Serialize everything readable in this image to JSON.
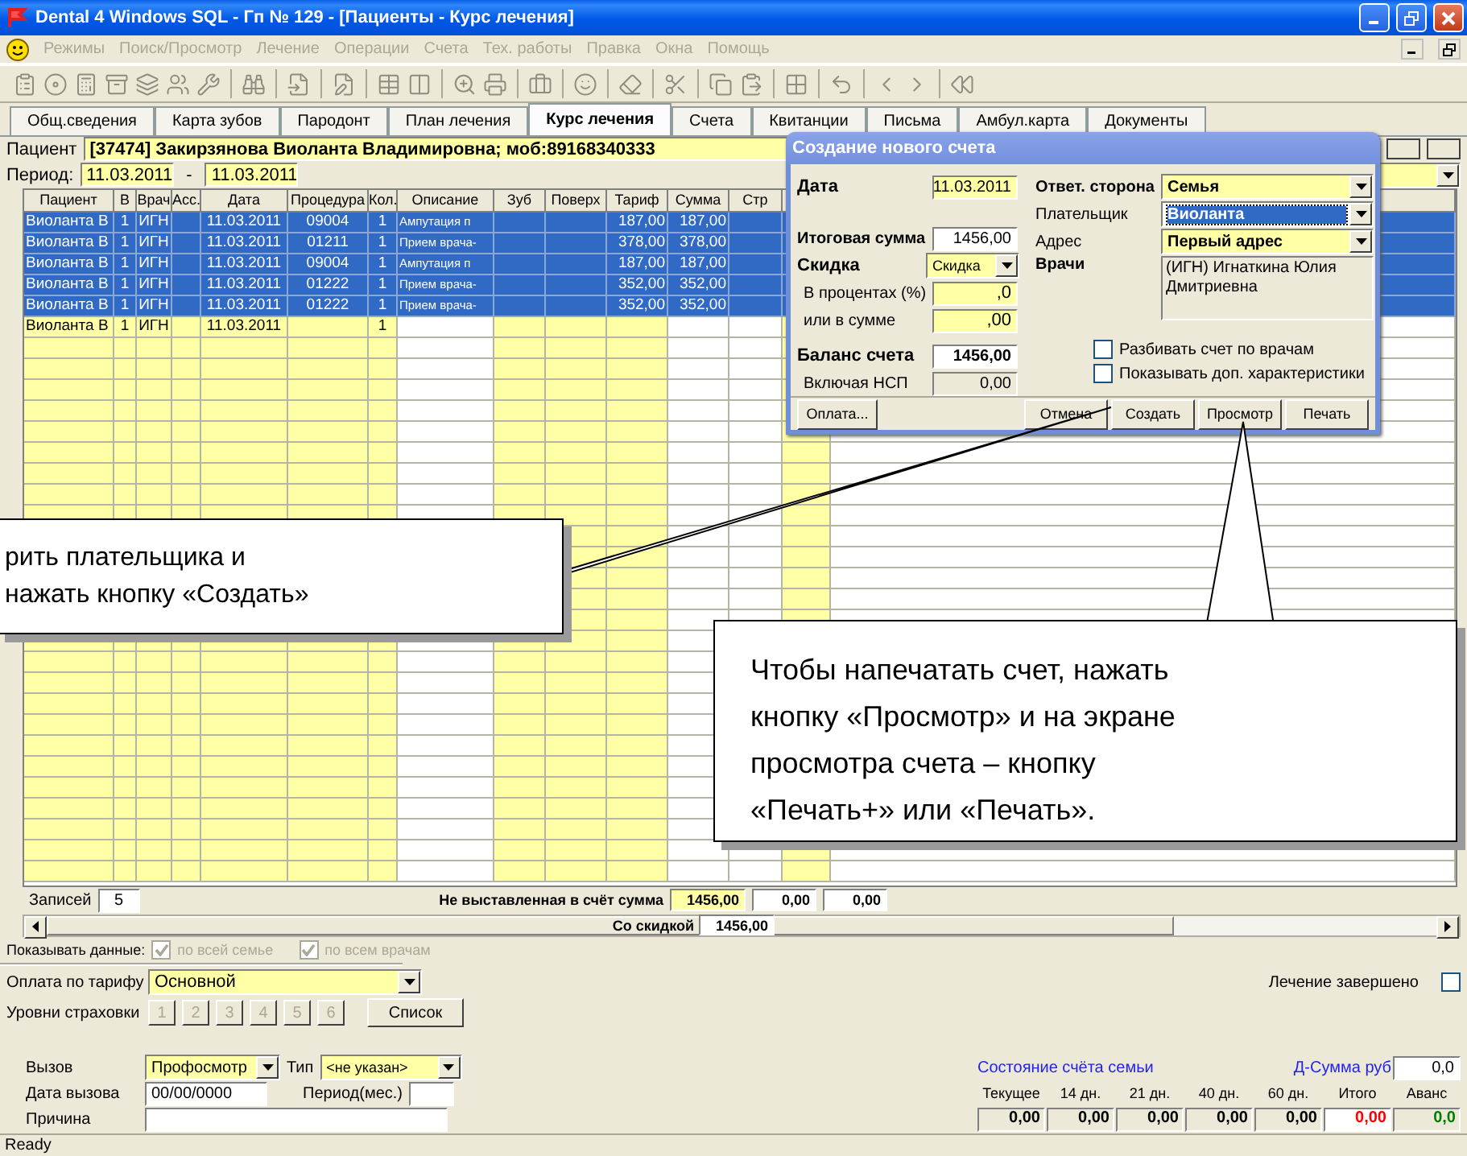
{
  "window": {
    "title": "Dental 4 Windows SQL - Гп № 129 - [Пациенты - Курс лечения]"
  },
  "menu": [
    {
      "label": "Режимы",
      "disabled": true
    },
    {
      "label": "Поиск/Просмотр",
      "disabled": true
    },
    {
      "label": "Лечение",
      "disabled": true
    },
    {
      "label": "Операции",
      "disabled": true
    },
    {
      "label": "Счета",
      "disabled": true
    },
    {
      "label": "Тех. работы",
      "disabled": true
    },
    {
      "label": "Правка",
      "disabled": true
    },
    {
      "label": "Окна",
      "disabled": true
    },
    {
      "label": "Помощь",
      "disabled": true
    }
  ],
  "tabs": [
    {
      "label": "Общ.сведения",
      "selected": false
    },
    {
      "label": "Карта зубов",
      "selected": false
    },
    {
      "label": "Пародонт",
      "selected": false
    },
    {
      "label": "План лечения",
      "selected": false
    },
    {
      "label": "Курс лечения",
      "selected": true
    },
    {
      "label": "Счета",
      "selected": false
    },
    {
      "label": "Квитанции",
      "selected": false
    },
    {
      "label": "Письма",
      "selected": false
    },
    {
      "label": "Амбул.карта",
      "selected": false
    },
    {
      "label": "Документы",
      "selected": false
    }
  ],
  "patient": {
    "label": "Пациент",
    "value": "[37474] Закирзянова Виоланта Владимировна; моб:89168340333"
  },
  "period": {
    "label": "Период:",
    "from": "11.03.2011",
    "separator": "-",
    "to": "11.03.2011"
  },
  "table": {
    "columns": [
      {
        "label": "Пациент",
        "editable": true
      },
      {
        "label": "В",
        "editable": true
      },
      {
        "label": "Врач",
        "editable": true
      },
      {
        "label": "Асс.",
        "editable": true
      },
      {
        "label": "Дата",
        "editable": true
      },
      {
        "label": "Процедура",
        "editable": true
      },
      {
        "label": "Кол.",
        "editable": true
      },
      {
        "label": "Описание",
        "editable": false
      },
      {
        "label": "Зуб",
        "editable": true
      },
      {
        "label": "Поверх",
        "editable": true
      },
      {
        "label": "Тариф",
        "editable": true
      },
      {
        "label": "Сумма",
        "editable": false
      },
      {
        "label": "Стр",
        "editable": false
      },
      {
        "editable": true
      }
    ],
    "rows": [
      {
        "selected": true,
        "cells": [
          "Виоланта В",
          "1",
          "ИГН",
          null,
          "11.03.2011",
          "09004",
          "1",
          "Ампутация п",
          null,
          null,
          "187,00",
          "187,00",
          null,
          null
        ]
      },
      {
        "selected": true,
        "cells": [
          "Виоланта В",
          "1",
          "ИГН",
          null,
          "11.03.2011",
          "01211",
          "1",
          "Прием врача-",
          null,
          null,
          "378,00",
          "378,00",
          null,
          null
        ]
      },
      {
        "selected": true,
        "cells": [
          "Виоланта В",
          "1",
          "ИГН",
          null,
          "11.03.2011",
          "09004",
          "1",
          "Ампутация п",
          null,
          null,
          "187,00",
          "187,00",
          null,
          null
        ]
      },
      {
        "selected": true,
        "cells": [
          "Виоланта В",
          "1",
          "ИГН",
          null,
          "11.03.2011",
          "01222",
          "1",
          "Прием врача-",
          null,
          null,
          "352,00",
          "352,00",
          null,
          null
        ]
      },
      {
        "selected": true,
        "cells": [
          "Виоланта В",
          "1",
          "ИГН",
          null,
          "11.03.2011",
          "01222",
          "1",
          "Прием врача-",
          null,
          null,
          "352,00",
          "352,00",
          null,
          null
        ]
      },
      {
        "selected": false,
        "cells": [
          "Виоланта В",
          "1",
          "ИГН",
          null,
          "11.03.2011",
          null,
          "1",
          null,
          null,
          null,
          null,
          null,
          null,
          null
        ]
      }
    ]
  },
  "totals": {
    "records_label": "Записей",
    "records": "5",
    "unbilled_label": "Не выставленная в счёт сумма",
    "unbilled": [
      "1456,00",
      "0,00",
      "0,00"
    ],
    "discounted_label": "Со скидкой",
    "discounted": "1456,00"
  },
  "show_data": {
    "label": "Показывать данные:",
    "options": [
      {
        "label": "по всей семье",
        "checked": true,
        "disabled": true
      },
      {
        "label": "по всем врачам",
        "checked": true,
        "disabled": true
      }
    ]
  },
  "tariff": {
    "label": "Оплата по тарифу",
    "value": "Основной"
  },
  "treatment_done": {
    "label": "Лечение завершено",
    "checked": false
  },
  "insurance": {
    "label": "Уровни страховки",
    "levels": [
      {
        "label": "1",
        "disabled": true
      },
      {
        "label": "2",
        "disabled": true
      },
      {
        "label": "3",
        "disabled": true
      },
      {
        "label": "4",
        "disabled": true
      },
      {
        "label": "5",
        "disabled": true
      },
      {
        "label": "6",
        "disabled": true
      }
    ],
    "button": "Список"
  },
  "call": {
    "label": "Вызов",
    "value": "Профосмотр",
    "type_label": "Тип",
    "type_value": "<не указан>",
    "date_label": "Дата вызова",
    "date_value": "00/00/0000",
    "period_label": "Период(мес.)",
    "reason_label": "Причина"
  },
  "family_account": {
    "title": "Состояние счёта семьи",
    "dsum_label": "Д-Сумма руб",
    "dsum_value": "0,0",
    "columns": [
      {
        "label": "Текущее",
        "value": "0,00",
        "kind": "plain"
      },
      {
        "label": "14 дн.",
        "value": "0,00",
        "kind": "plain"
      },
      {
        "label": "21 дн.",
        "value": "0,00",
        "kind": "plain"
      },
      {
        "label": "40 дн.",
        "value": "0,00",
        "kind": "plain"
      },
      {
        "label": "60 дн.",
        "value": "0,00",
        "kind": "plain"
      },
      {
        "label": "Итого",
        "value": "0,00",
        "kind": "total"
      },
      {
        "label": "Аванс",
        "value": "0,0",
        "kind": "advance"
      }
    ]
  },
  "dialog": {
    "title": "Создание нового счета",
    "date": {
      "label": "Дата",
      "value": "11.03.2011"
    },
    "total": {
      "label": "Итоговая сумма",
      "value": "1456,00"
    },
    "discount": {
      "label": "Скидка",
      "value": "Скидка"
    },
    "percent": {
      "label": "В процентах (%)",
      "value": ",0"
    },
    "amount": {
      "label": "или в сумме",
      "value": ",00"
    },
    "balance": {
      "label": "Баланс счета",
      "value": "1456,00"
    },
    "vat": {
      "label": "Включая НСП",
      "value": "0,00"
    },
    "responsible": {
      "label": "Ответ. сторона",
      "value": "Семья"
    },
    "payer": {
      "label": "Плательщик",
      "value": "Виоланта",
      "focused": true
    },
    "address": {
      "label": "Адрес",
      "value": "Первый адрес"
    },
    "doctors": {
      "label": "Врачи",
      "value": "(ИГН) Игнаткина  Юлия Дмитриевна"
    },
    "checkboxes": [
      {
        "label": "Разбивать счет по врачам",
        "checked": false
      },
      {
        "label": "Показывать доп. характеристики",
        "checked": false
      }
    ],
    "buttons": [
      {
        "label": "Оплата..."
      },
      {
        "label": "Отмена"
      },
      {
        "label": "Создать"
      },
      {
        "label": "Просмотр"
      },
      {
        "label": "Печать"
      }
    ]
  },
  "callouts": [
    {
      "text": "рить плательщика и\nнажать кнопку «Создать»"
    },
    {
      "text": "Чтобы напечатать счет, нажать\nкнопку «Просмотр» и на экране\nпросмотра счета – кнопку\n«Печать+» или «Печать»."
    }
  ],
  "status_bar": "Ready"
}
